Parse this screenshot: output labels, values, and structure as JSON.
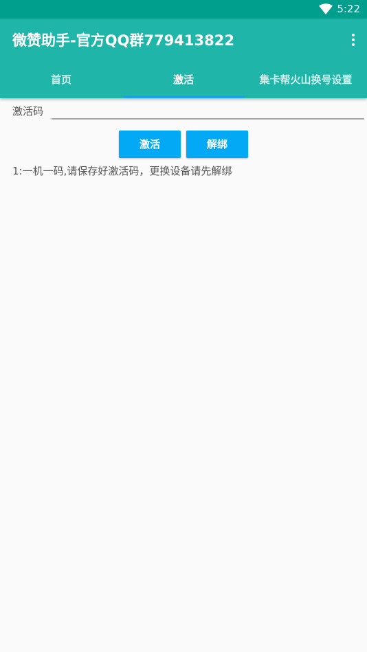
{
  "status_bar": {
    "time": "5:22",
    "wifi_icon": "wifi-icon"
  },
  "app_bar": {
    "title": "微赞助手-官方QQ群779413822",
    "overflow_icon": "more-vert-icon",
    "background_color": "#1fb5a9"
  },
  "tabs": [
    {
      "label": "首页",
      "active": false
    },
    {
      "label": "激活",
      "active": true
    },
    {
      "label": "集卡帮火山换号设置",
      "active": false
    }
  ],
  "form": {
    "code_label": "激活码",
    "code_value": "",
    "activate_label": "激活",
    "unbind_label": "解绑",
    "note": "1:一机一码,请保存好激活码，更换设备请先解绑"
  },
  "colors": {
    "status_bar": "#009e8d",
    "accent": "#03a9f4",
    "indicator": "#1ea0f0"
  }
}
